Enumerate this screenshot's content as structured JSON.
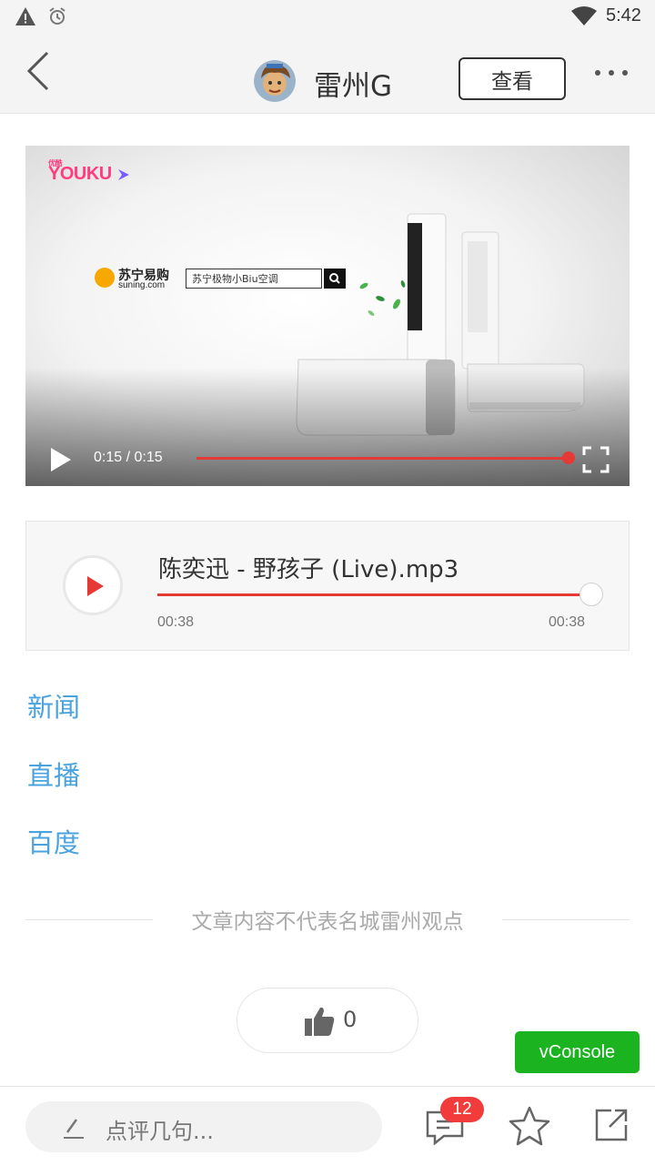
{
  "status_bar": {
    "time": "5:42",
    "icons": [
      "warning-icon",
      "alarm-icon",
      "wifi-icon"
    ]
  },
  "header": {
    "title": "雷州G",
    "view_button": "查看"
  },
  "video": {
    "watermark": "YOUKU",
    "watermark_tag": "优酷",
    "ad_brand": "苏宁易购",
    "ad_url": "suning.com",
    "ad_search_text": "苏宁极物小Biu空调",
    "time": "0:15 / 0:15",
    "progress": 1.0
  },
  "audio": {
    "title": "陈奕迅 - 野孩子 (Live).mp3",
    "current": "00:38",
    "duration": "00:38",
    "progress": 1.0
  },
  "links": [
    "新闻",
    "直播",
    "百度"
  ],
  "disclaimer": "文章内容不代表名城雷州观点",
  "like": {
    "count": "0"
  },
  "vconsole": "vConsole",
  "bottom_bar": {
    "comment_placeholder": "点评几句...",
    "message_badge": "12"
  },
  "colors": {
    "accent_red": "#e53935",
    "link_blue": "#4aa3df",
    "vconsole_green": "#1bb320"
  }
}
